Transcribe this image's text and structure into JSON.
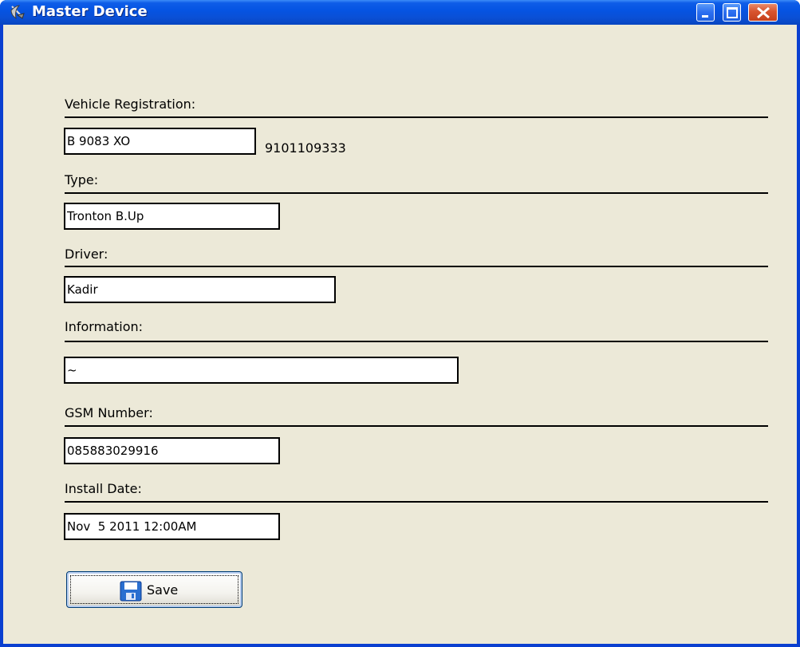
{
  "window": {
    "title": "Master Device"
  },
  "form": {
    "vehicle_registration": {
      "label": "Vehicle Registration:",
      "value": "B 9083 XO",
      "side_text": "9101109333"
    },
    "type": {
      "label": "Type:",
      "value": "Tronton B.Up"
    },
    "driver": {
      "label": "Driver:",
      "value": "Kadir"
    },
    "information": {
      "label": "Information:",
      "value": "~"
    },
    "gsm_number": {
      "label": "GSM Number:",
      "value": "085883029916"
    },
    "install_date": {
      "label": "Install Date:",
      "value": "Nov  5 2011 12:00AM"
    }
  },
  "actions": {
    "save_label": "Save"
  },
  "icons": {
    "title_icon": "satellite-dish-icon",
    "save_icon": "floppy-disk-icon"
  }
}
